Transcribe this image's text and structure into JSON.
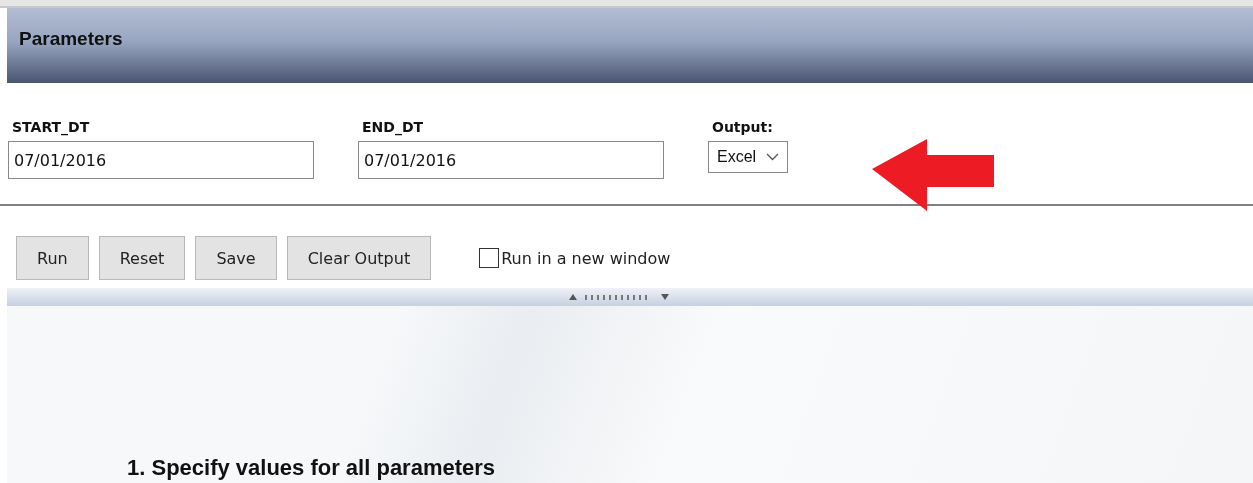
{
  "panel": {
    "title": "Parameters"
  },
  "parameters": [
    {
      "kind": "text",
      "label": "START_DT",
      "value": "07/01/2016"
    },
    {
      "kind": "text",
      "label": "END_DT",
      "value": "07/01/2016"
    },
    {
      "kind": "select",
      "label": "Output:",
      "value": "Excel"
    }
  ],
  "buttons": [
    "Run",
    "Reset",
    "Save",
    "Clear Output"
  ],
  "new_window": {
    "label": "Run in a new window",
    "checked": false
  },
  "output": {
    "instruction": "1. Specify values for all parameters"
  }
}
